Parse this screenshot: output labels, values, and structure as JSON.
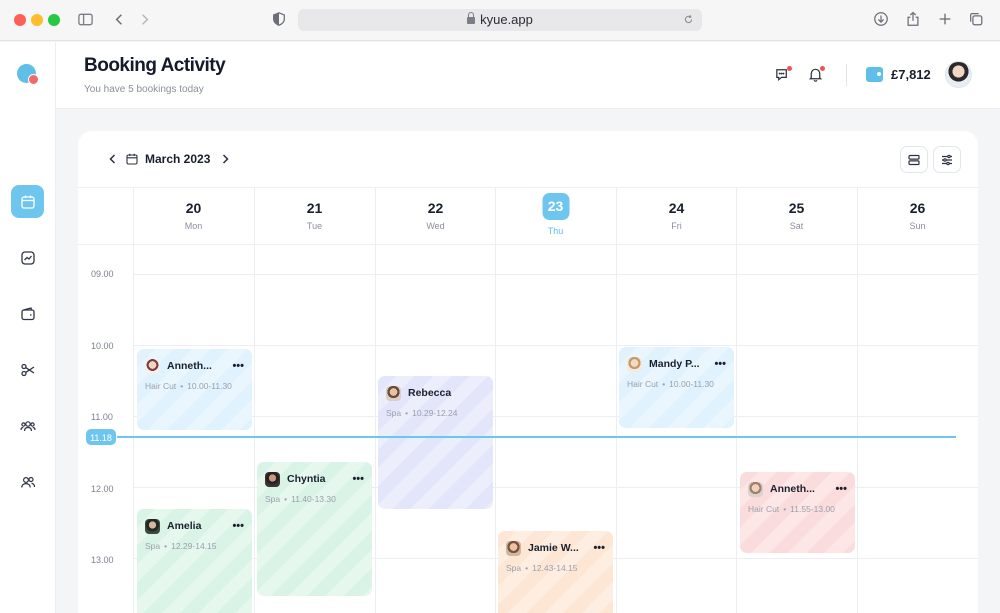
{
  "browser": {
    "url": "kyue.app"
  },
  "header": {
    "title": "Booking Activity",
    "subtitle": "You have 5 bookings today",
    "balance": "£7,812"
  },
  "calendar": {
    "month": "March 2023",
    "days": [
      {
        "num": "20",
        "name": "Mon"
      },
      {
        "num": "21",
        "name": "Tue"
      },
      {
        "num": "22",
        "name": "Wed"
      },
      {
        "num": "23",
        "name": "Thu"
      },
      {
        "num": "24",
        "name": "Fri"
      },
      {
        "num": "25",
        "name": "Sat"
      },
      {
        "num": "26",
        "name": "Sun"
      }
    ],
    "times": [
      "09.00",
      "10.00",
      "11.00",
      "12.00",
      "13.00"
    ],
    "now": "11.18",
    "events": [
      {
        "name": "Anneth...",
        "service": "Hair Cut",
        "time": "10.00-11.30"
      },
      {
        "name": "Rebecca",
        "service": "Spa",
        "time": "10.29-12.24"
      },
      {
        "name": "Mandy P...",
        "service": "Hair Cut",
        "time": "10.00-11.30"
      },
      {
        "name": "Chyntia",
        "service": "Spa",
        "time": "11.40-13.30"
      },
      {
        "name": "Anneth...",
        "service": "Hair Cut",
        "time": "11.55-13.00"
      },
      {
        "name": "Amelia",
        "service": "Spa",
        "time": "12.29-14.15"
      },
      {
        "name": "Jamie W...",
        "service": "Spa",
        "time": "12.43-14.15"
      }
    ],
    "more_glyph": "•••",
    "separator": "•"
  }
}
